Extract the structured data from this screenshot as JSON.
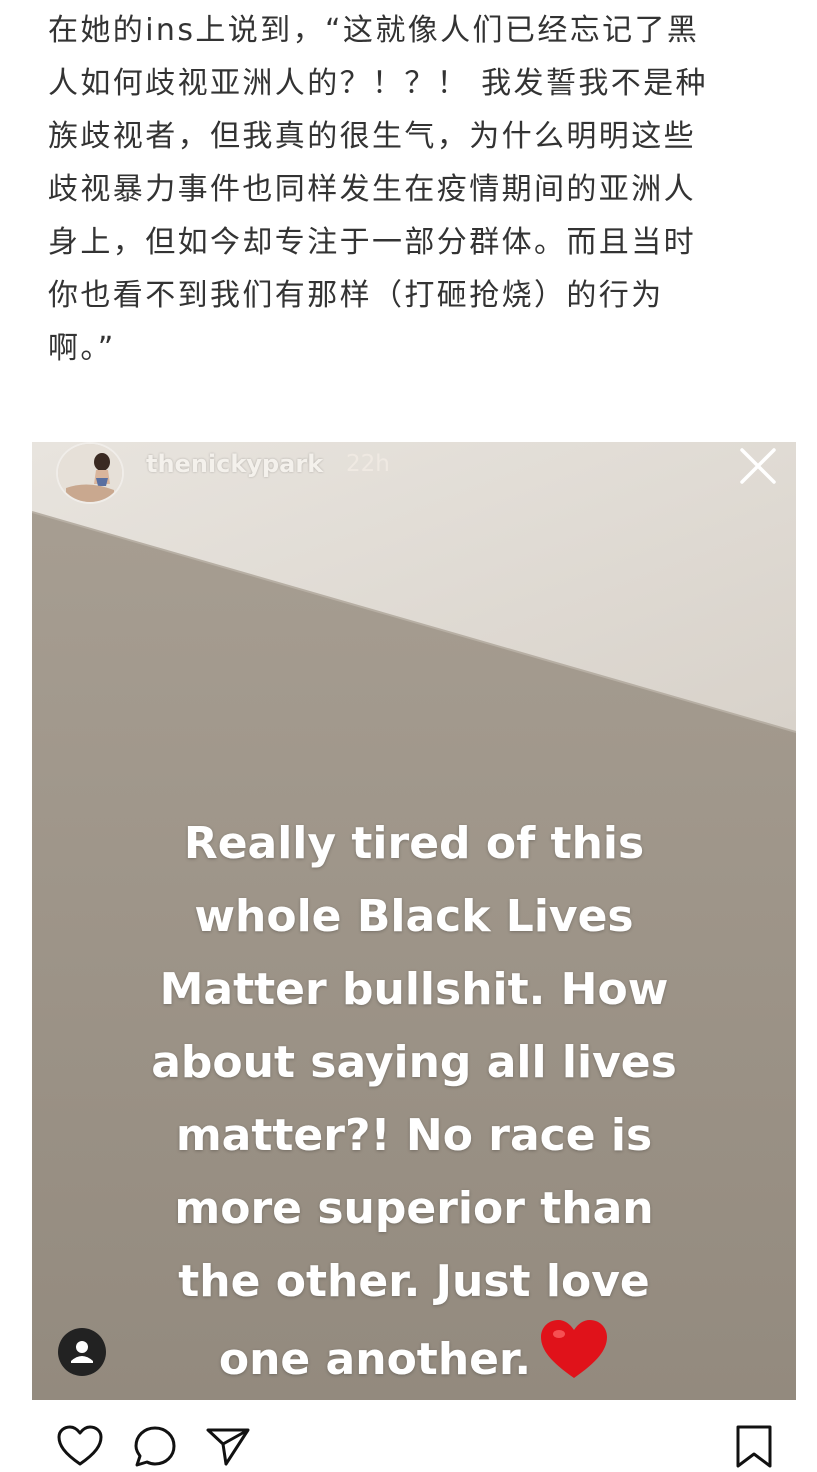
{
  "article": {
    "lines": [
      "在她的ins上说到，“这就像人们已经忘记了黑",
      "人如何歧视亚洲人的？！？！ 我发誓我不是种",
      "族歧视者，但我真的很生气，为什么明明这些",
      "歧视暴力事件也同样发生在疫情期间的亚洲人",
      "身上，但如今却专注于一部分群体。而且当时",
      "你也看不到我们有那样（打砸抢烧）的行为",
      "啊。”"
    ]
  },
  "story": {
    "username": "thenickypark",
    "timestamp": "22h",
    "caption_lines": [
      "Really tired of this",
      "whole Black Lives",
      "Matter bullshit. How",
      "about saying all lives",
      "matter?! No race is",
      "more superior than",
      "the other. Just love",
      "one another."
    ],
    "icons": {
      "avatar": "avatar",
      "close": "close-icon",
      "heart": "heart-icon",
      "profile": "profile-icon"
    },
    "colors": {
      "wall": "#9c9386",
      "ceiling": "#e2ddd6",
      "heart": "#e0121a"
    }
  },
  "actions": {
    "icons": [
      "heart-outline-icon",
      "comment-icon",
      "share-icon",
      "bookmark-icon"
    ]
  }
}
